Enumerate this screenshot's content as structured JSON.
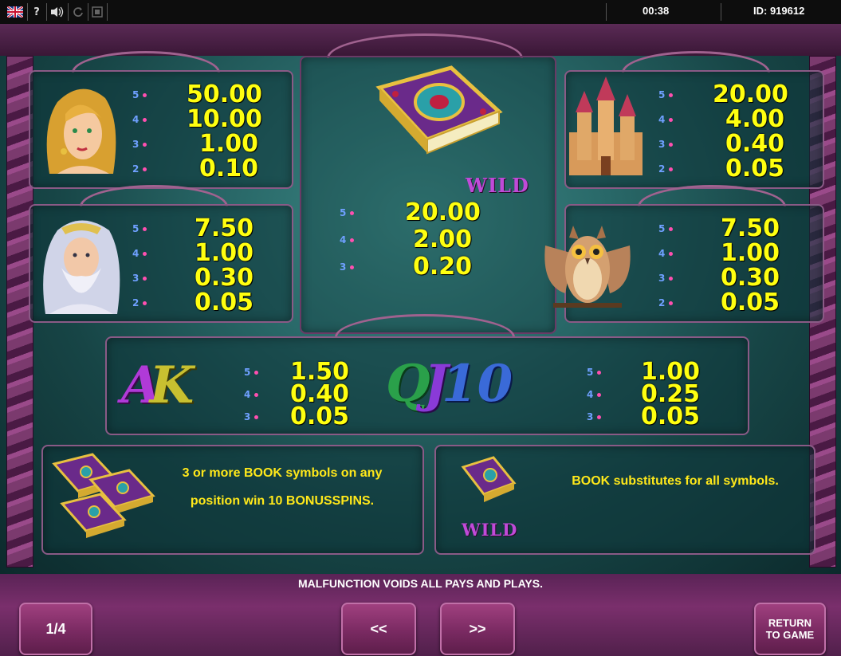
{
  "topbar": {
    "flag_icon": "uk-flag-icon",
    "help_label": "?",
    "sound_icon": "speaker-icon",
    "reload_icon": "reload-icon",
    "fullscreen_icon": "fullscreen-icon",
    "time": "00:38",
    "id": "ID: 919612"
  },
  "paytable": {
    "maiden": {
      "symbol": "maiden",
      "rows": [
        {
          "mult": "5",
          "value": "50.00"
        },
        {
          "mult": "4",
          "value": "10.00"
        },
        {
          "mult": "3",
          "value": "1.00"
        },
        {
          "mult": "2",
          "value": "0.10"
        }
      ]
    },
    "wizard": {
      "symbol": "wizard",
      "rows": [
        {
          "mult": "5",
          "value": "7.50"
        },
        {
          "mult": "4",
          "value": "1.00"
        },
        {
          "mult": "3",
          "value": "0.30"
        },
        {
          "mult": "2",
          "value": "0.05"
        }
      ]
    },
    "book": {
      "symbol": "book",
      "wild_label": "WILD",
      "rows": [
        {
          "mult": "5",
          "value": "20.00"
        },
        {
          "mult": "4",
          "value": "2.00"
        },
        {
          "mult": "3",
          "value": "0.20"
        }
      ]
    },
    "castle": {
      "symbol": "castle",
      "rows": [
        {
          "mult": "5",
          "value": "20.00"
        },
        {
          "mult": "4",
          "value": "4.00"
        },
        {
          "mult": "3",
          "value": "0.40"
        },
        {
          "mult": "2",
          "value": "0.05"
        }
      ]
    },
    "owl": {
      "symbol": "owl",
      "rows": [
        {
          "mult": "5",
          "value": "7.50"
        },
        {
          "mult": "4",
          "value": "1.00"
        },
        {
          "mult": "3",
          "value": "0.30"
        },
        {
          "mult": "2",
          "value": "0.05"
        }
      ]
    },
    "ak": {
      "letters": [
        "A",
        "K"
      ],
      "rows": [
        {
          "mult": "5",
          "value": "1.50"
        },
        {
          "mult": "4",
          "value": "0.40"
        },
        {
          "mult": "3",
          "value": "0.05"
        }
      ]
    },
    "qj10": {
      "letters": [
        "Q",
        "J",
        "10"
      ],
      "rows": [
        {
          "mult": "5",
          "value": "1.00"
        },
        {
          "mult": "4",
          "value": "0.25"
        },
        {
          "mult": "3",
          "value": "0.05"
        }
      ]
    }
  },
  "info": {
    "bonus_text": "3 or more BOOK symbols on any position win 10 BONUSSPINS.",
    "wild_label": "WILD",
    "wild_text": "BOOK substitutes for all symbols."
  },
  "footer": {
    "disclaimer": "MALFUNCTION VOIDS ALL PAYS AND PLAYS.",
    "page": "1/4",
    "prev": "<<",
    "next": ">>",
    "return_line1": "RETURN",
    "return_line2": "TO GAME"
  },
  "colors": {
    "value": "#ffff10",
    "accent": "#8a3a7e",
    "multiplier": "#6fa0ff"
  }
}
